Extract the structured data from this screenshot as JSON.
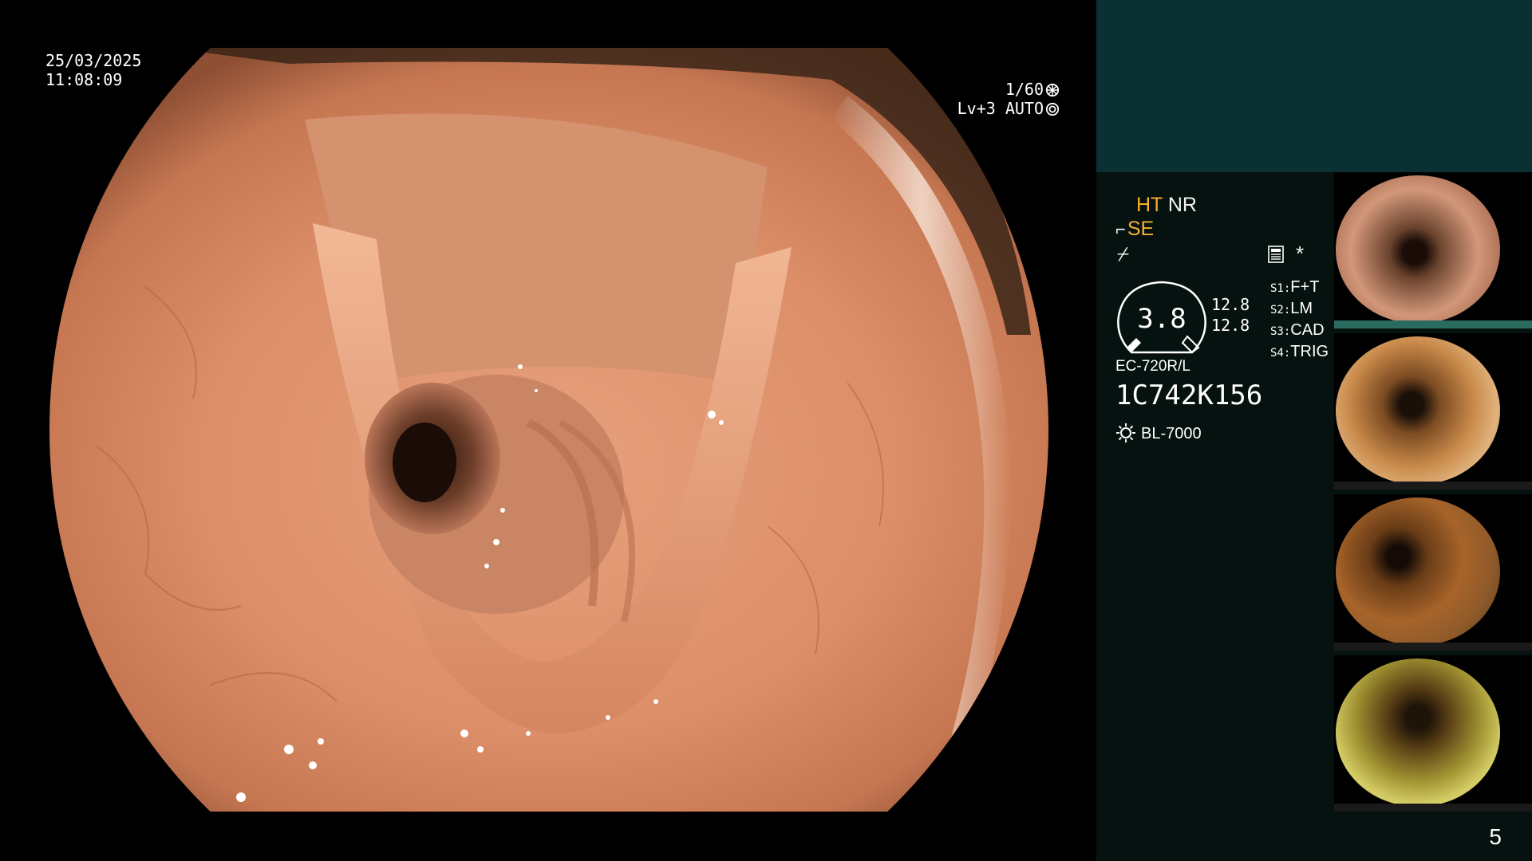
{
  "overlay": {
    "date": "25/03/2025",
    "time": "11:08:09",
    "shutter": "1/60",
    "level": "Lv+3 AUTO"
  },
  "panel": {
    "ht": "HT",
    "nr": "NR",
    "se": "SE",
    "freeze_symbol": "⌿",
    "asterisk": "*",
    "gauge_value": "3.8",
    "num_a": "12.8",
    "num_b": "12.8",
    "s_items": [
      {
        "key": "S1:",
        "value": "F+T"
      },
      {
        "key": "S2:",
        "value": "LM"
      },
      {
        "key": "S3:",
        "value": "CAD"
      },
      {
        "key": "S4:",
        "value": "TRIG"
      }
    ],
    "scope_model": "EC-720R/L",
    "serial": "1C742K156",
    "light_source": "BL-7000"
  },
  "thumbnails": [
    {
      "tint": "#6b4b3b",
      "bar": "#2a6b5f"
    },
    {
      "tint": "#a6703d",
      "bar": "#1a1a1a"
    },
    {
      "tint": "#8a5a2a",
      "bar": "#1a1a1a"
    },
    {
      "tint": "#8c8a32",
      "bar": "#1a1a1a"
    }
  ],
  "page_number": "5",
  "colors": {
    "accent_amber": "#f5b02c",
    "panel_bg": "#051210",
    "panel_top": "#0b3033"
  }
}
